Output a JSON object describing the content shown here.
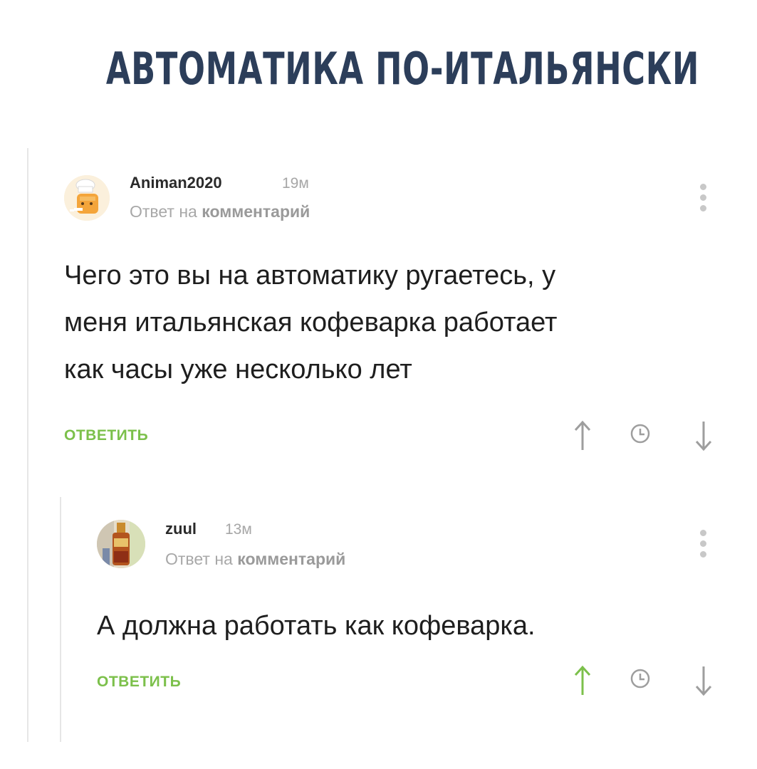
{
  "page": {
    "title": "АВТОМАТИКА ПО-ИТАЛЬЯНСКИ"
  },
  "colors": {
    "title": "#2c3e5a",
    "accent_green": "#7cc04b",
    "muted_gray": "#a8a8a8",
    "icon_gray": "#a0a0a0"
  },
  "comments": [
    {
      "username": "Animan2020",
      "time": "19м",
      "reply_prefix": "Ответ на",
      "reply_link": "комментарий",
      "avatar_icon": "chef-hat-avatar-icon",
      "lines": [
        "Чего это вы на автоматику ругаетесь, у",
        "меня итальянская кофеварка работает",
        "как часы уже несколько лет"
      ],
      "reply_label": "ОТВЕТИТЬ",
      "upvoted": false
    },
    {
      "username": "zuul",
      "time": "13м",
      "reply_prefix": "Ответ на",
      "reply_link": "комментарий",
      "avatar_icon": "bottle-photo-avatar-icon",
      "lines": [
        "А должна работать как кофеварка."
      ],
      "reply_label": "ОТВЕТИТЬ",
      "upvoted": true
    }
  ]
}
